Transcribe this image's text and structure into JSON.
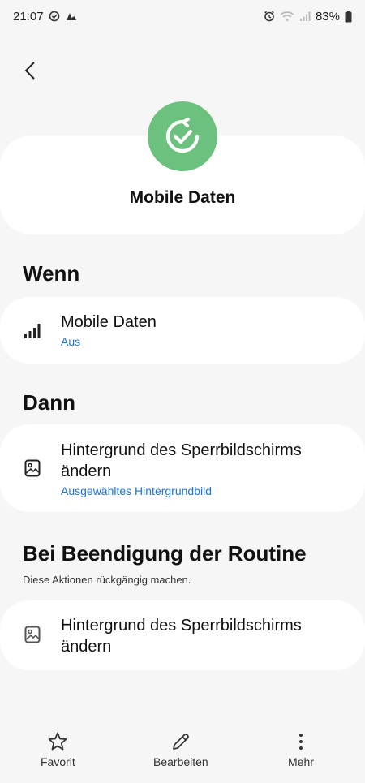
{
  "status_bar": {
    "time": "21:07",
    "battery": "83%"
  },
  "routine": {
    "title": "Mobile Daten",
    "icon": "check-refresh-icon",
    "icon_color": "#6cc17e"
  },
  "sections": {
    "if": {
      "heading": "Wenn",
      "card": {
        "title": "Mobile Daten",
        "subtitle": "Aus",
        "icon": "signal-bars-icon"
      }
    },
    "then": {
      "heading": "Dann",
      "card": {
        "title": "Hintergrund des Sperrbildschirms ändern",
        "subtitle": "Ausgewähltes Hintergrundbild",
        "icon": "image-icon"
      }
    },
    "end": {
      "heading": "Bei Beendigung der Routine",
      "subtitle": "Diese Aktionen rückgängig machen.",
      "card": {
        "title": "Hintergrund des Sperrbildschirms ändern",
        "icon": "image-icon"
      }
    }
  },
  "bottom_nav": {
    "favorite": "Favorit",
    "edit": "Bearbeiten",
    "more": "Mehr"
  },
  "colors": {
    "accent_link": "#1d73d9",
    "background": "#f6f6f6"
  }
}
